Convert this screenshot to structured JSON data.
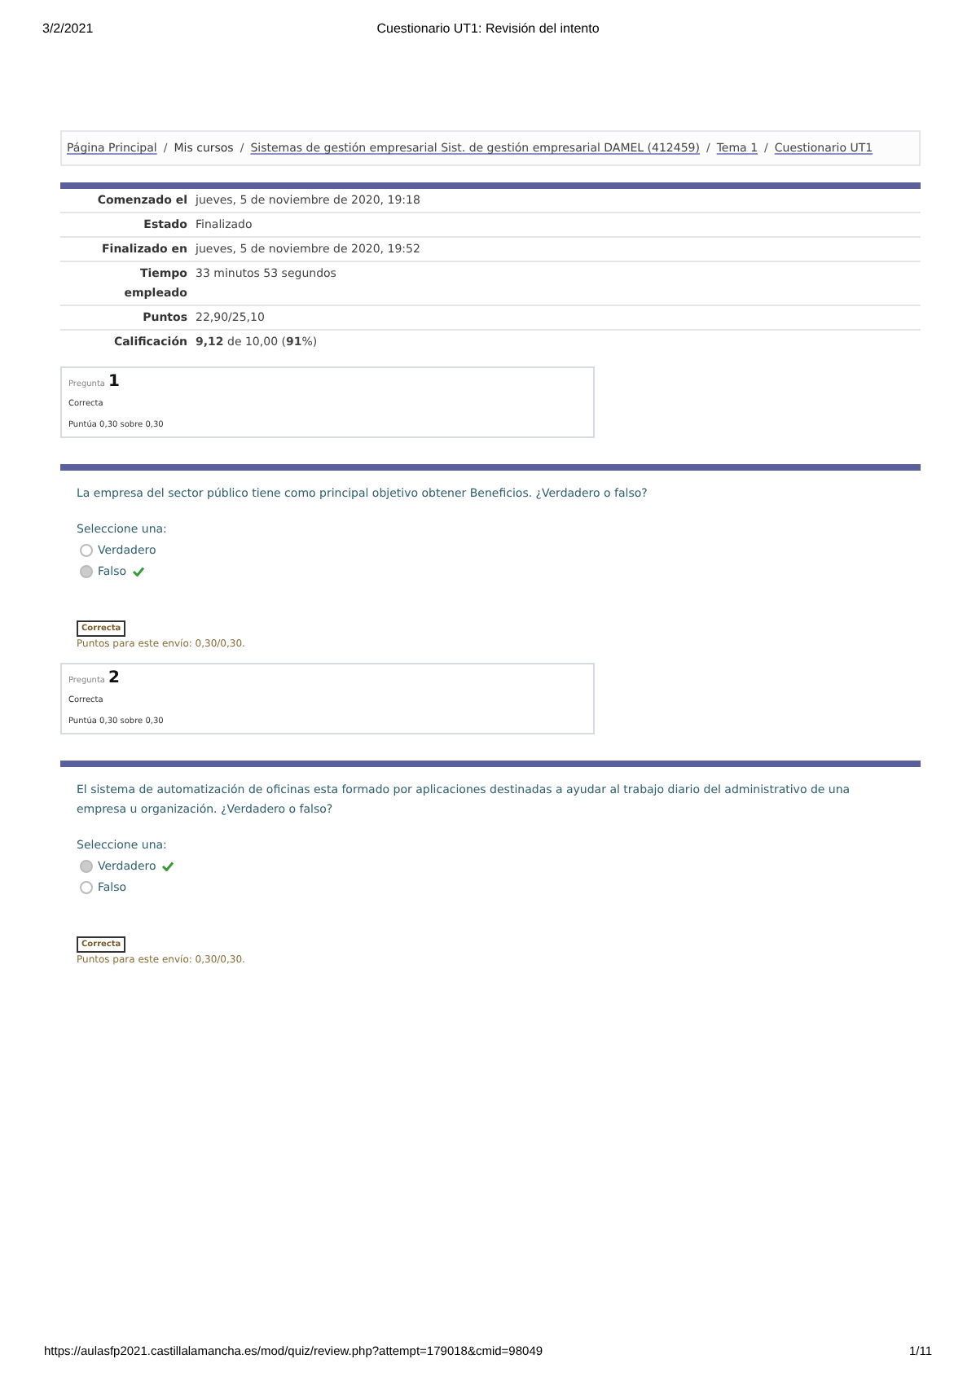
{
  "header": {
    "date": "3/2/2021",
    "title": "Cuestionario UT1: Revisión del intento"
  },
  "breadcrumb": [
    {
      "label": "Página Principal",
      "link": true
    },
    {
      "separator": "/",
      "label": "Mis cursos",
      "link": false
    },
    {
      "separator": "/",
      "label": "Sistemas de gestión empresarial Sist. de gestión empresarial DAMEL (412459)",
      "link": true
    },
    {
      "separator": "/",
      "label": "Tema 1",
      "link": true
    },
    {
      "separator": "/",
      "label": "Cuestionario UT1",
      "link": true
    }
  ],
  "summary": [
    {
      "label": "Comenzado el",
      "value": "jueves, 5 de noviembre de 2020, 19:18"
    },
    {
      "label": "Estado",
      "value": "Finalizado"
    },
    {
      "label": "Finalizado en",
      "value": "jueves, 5 de noviembre de 2020, 19:52"
    },
    {
      "label": "Tiempo empleado",
      "value": "33 minutos 53 segundos"
    },
    {
      "label": "Puntos",
      "value": "22,90/25,10"
    },
    {
      "label": "Calificación",
      "value": "**9,12** de 10,00 (**91**%)"
    }
  ],
  "questions": [
    {
      "caption": "Pregunta",
      "number": "1",
      "state": "Correcta",
      "mark": "Puntúa 0,30 sobre 0,30",
      "text": "La empresa del sector público tiene como principal objetivo obtener Beneficios. ¿Verdadero o falso?",
      "prompt": "Seleccione una:",
      "options": [
        {
          "label": "Verdadero",
          "selected": false,
          "correct": false
        },
        {
          "label": "Falso",
          "selected": true,
          "correct": true
        }
      ],
      "badge": "Correcta",
      "points": "Puntos para este envío: 0,30/0,30."
    },
    {
      "caption": "Pregunta",
      "number": "2",
      "state": "Correcta",
      "mark": "Puntúa 0,30 sobre 0,30",
      "text": "El sistema de automatización de oficinas esta formado por aplicaciones destinadas a ayudar al trabajo diario del administrativo de una empresa u organización. ¿Verdadero o falso?",
      "prompt": "Seleccione una:",
      "options": [
        {
          "label": "Verdadero",
          "selected": true,
          "correct": true
        },
        {
          "label": "Falso",
          "selected": false,
          "correct": false
        }
      ],
      "badge": "Correcta",
      "points": "Puntos para este envío: 0,30/0,30."
    }
  ],
  "footer": {
    "url": "https://aulasfp2021.castillalamancha.es/mod/quiz/review.php?attempt=179018&cmid=98049",
    "page": "1/11"
  }
}
